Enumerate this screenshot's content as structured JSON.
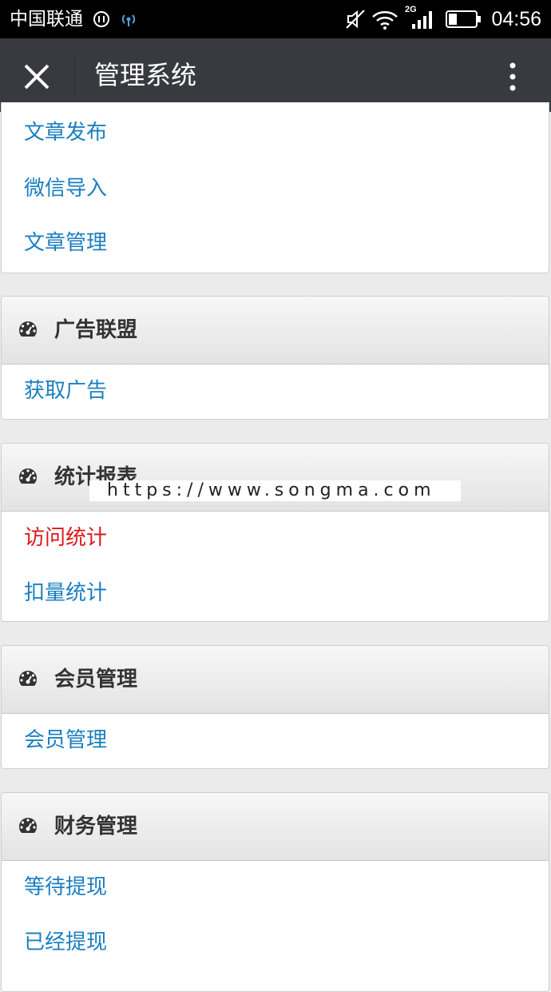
{
  "status_bar": {
    "carrier": "中国联通",
    "network": "2G",
    "time": "04:56"
  },
  "title_bar": {
    "title": "管理系统",
    "close_icon": "close-icon",
    "menu_icon": "more-vert-icon"
  },
  "sections": [
    {
      "title": "",
      "items": [
        "文章发布",
        "微信导入",
        "文章管理"
      ]
    },
    {
      "title": "广告联盟",
      "icon": "dashboard-icon",
      "items": [
        "获取广告"
      ]
    },
    {
      "title": "统计报表",
      "icon": "dashboard-icon",
      "items": [
        "访问统计",
        "扣量统计"
      ]
    },
    {
      "title": "会员管理",
      "icon": "dashboard-icon",
      "items": [
        "会员管理"
      ]
    },
    {
      "title": "财务管理",
      "icon": "dashboard-icon",
      "items": [
        "等待提现",
        "已经提现"
      ]
    }
  ],
  "watermark": "https://www.songma.com",
  "colors": {
    "link": "#1a7fc0",
    "active_link": "#d9191a",
    "title_bar": "#393a3f",
    "background": "#ebebeb"
  }
}
